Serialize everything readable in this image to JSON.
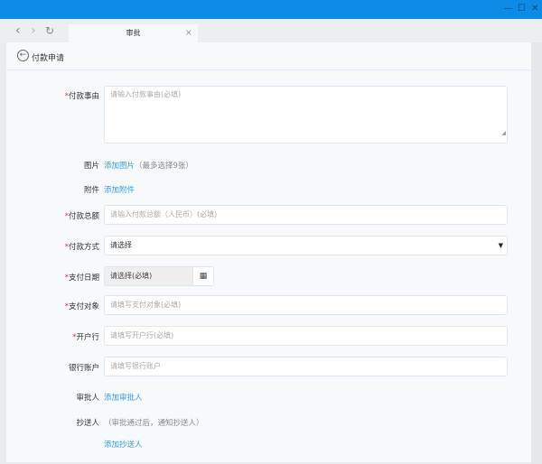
{
  "window": {
    "minimize": "—",
    "maximize": "☐",
    "close": "✕",
    "accent": "#0a8be6"
  },
  "browser": {
    "back": "‹",
    "forward": "›",
    "reload": "↻",
    "tab_title": "审批",
    "tab_close": "×"
  },
  "page": {
    "title": "付款申请",
    "back_icon": "arrow-left-circle-icon"
  },
  "form": {
    "reason": {
      "label": "付款事由",
      "placeholder": "请输入付款事由(必填)"
    },
    "images": {
      "label": "图片",
      "link": "添加图片",
      "hint": "（最多选择9张）"
    },
    "attachments": {
      "label": "附件",
      "link": "添加附件"
    },
    "amount": {
      "label": "付款总额",
      "placeholder": "请输入付款总额（人民币）(必填)"
    },
    "method": {
      "label": "付款方式",
      "value": "请选择"
    },
    "date": {
      "label": "支付日期",
      "value": "请选择(必填)",
      "icon": "calendar-icon"
    },
    "payee": {
      "label": "支付对象",
      "placeholder": "请填写支付对象(必填)"
    },
    "bank": {
      "label": "开户行",
      "placeholder": "请填写开户行(必填)"
    },
    "account": {
      "label": "银行账户",
      "placeholder": "请填写银行账户"
    },
    "approver": {
      "label": "审批人",
      "link": "添加审批人"
    },
    "cc": {
      "label": "抄送人",
      "hint": "（审批通过后，通知抄送人）",
      "link": "添加抄送人"
    },
    "required_mark": "*"
  }
}
